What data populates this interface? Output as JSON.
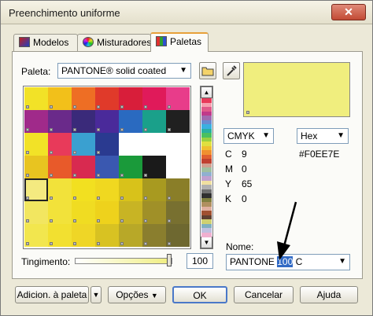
{
  "window": {
    "title": "Preenchimento uniforme",
    "close_glyph": "✕"
  },
  "tabs": [
    {
      "label": "Modelos",
      "icon": "models-icon"
    },
    {
      "label": "Misturadores",
      "icon": "mixers-icon"
    },
    {
      "label": "Paletas",
      "icon": "palettes-icon"
    }
  ],
  "palette": {
    "label": "Paleta:",
    "selected": "PANTONE® solid coated"
  },
  "color_model": {
    "selected": "CMYK",
    "values": [
      {
        "label": "C",
        "value": "9"
      },
      {
        "label": "M",
        "value": "0"
      },
      {
        "label": "Y",
        "value": "65"
      },
      {
        "label": "K",
        "value": "0"
      }
    ]
  },
  "hex": {
    "selected": "Hex",
    "value": "#F0EE7E"
  },
  "tint": {
    "label": "Tingimento:",
    "value": "100",
    "level_percent": 100
  },
  "name": {
    "label": "Nome:",
    "prefix": "PANTONE ",
    "highlight": "100",
    "suffix": " C"
  },
  "buttons": {
    "add_to_palette": "Adicion. à paleta",
    "options": "Opções",
    "ok": "OK",
    "cancel": "Cancelar",
    "help": "Ajuda"
  },
  "swatch_grid": [
    [
      "#f2e227",
      "#f2c01a",
      "#ee6e24",
      "#e03a2a",
      "#d81e3a",
      "#e01a5a",
      "#e83c8a"
    ],
    [
      "#a02a8a",
      "#6a2a8a",
      "#3a2a7a",
      "#4a2a9a",
      "#2a6ac0",
      "#1aa08a",
      "#202020"
    ],
    [
      "#f2e227",
      "#e83a5a",
      "#3aa0d0",
      "#2a3a90",
      "#ffffff",
      "#ffffff",
      "#ffffff"
    ],
    [
      "#e8c420",
      "#e85a2a",
      "#d82a50",
      "#3a58b0",
      "#1a9a3a",
      "#1a1a1a",
      "#ffffff"
    ],
    [
      "#f4ea80",
      "#f2e23a",
      "#f2e020",
      "#f0d820",
      "#d8c21a",
      "#a89a20",
      "#8a7e28"
    ],
    [
      "#f2e660",
      "#f2e23a",
      "#f0dc22",
      "#eed21c",
      "#c8b424",
      "#a09028",
      "#787030"
    ],
    [
      "#f2e64e",
      "#f2e030",
      "#efd626",
      "#d8c222",
      "#b8a828",
      "#8a7e2e",
      "#6e6830"
    ]
  ],
  "selected_swatch": [
    4,
    0
  ],
  "strip_colors": [
    "#e83a5a",
    "#f5a0b0",
    "#e05a8a",
    "#c03a8a",
    "#a06ab0",
    "#6a8ad0",
    "#3ab0e0",
    "#2ab0a0",
    "#4ac060",
    "#9ad040",
    "#e0e040",
    "#f0c030",
    "#f09030",
    "#e06030",
    "#c04030",
    "#d0a090",
    "#a0c0a0",
    "#90b0d0",
    "#c0a0d0",
    "#f0e0a0",
    "#b0b0b0",
    "#707070",
    "#303030",
    "#808040",
    "#b09060",
    "#e0b0a0",
    "#a05030",
    "#604030",
    "#d0d070",
    "#80b0c0",
    "#c0c0e0",
    "#f0b0d0"
  ]
}
